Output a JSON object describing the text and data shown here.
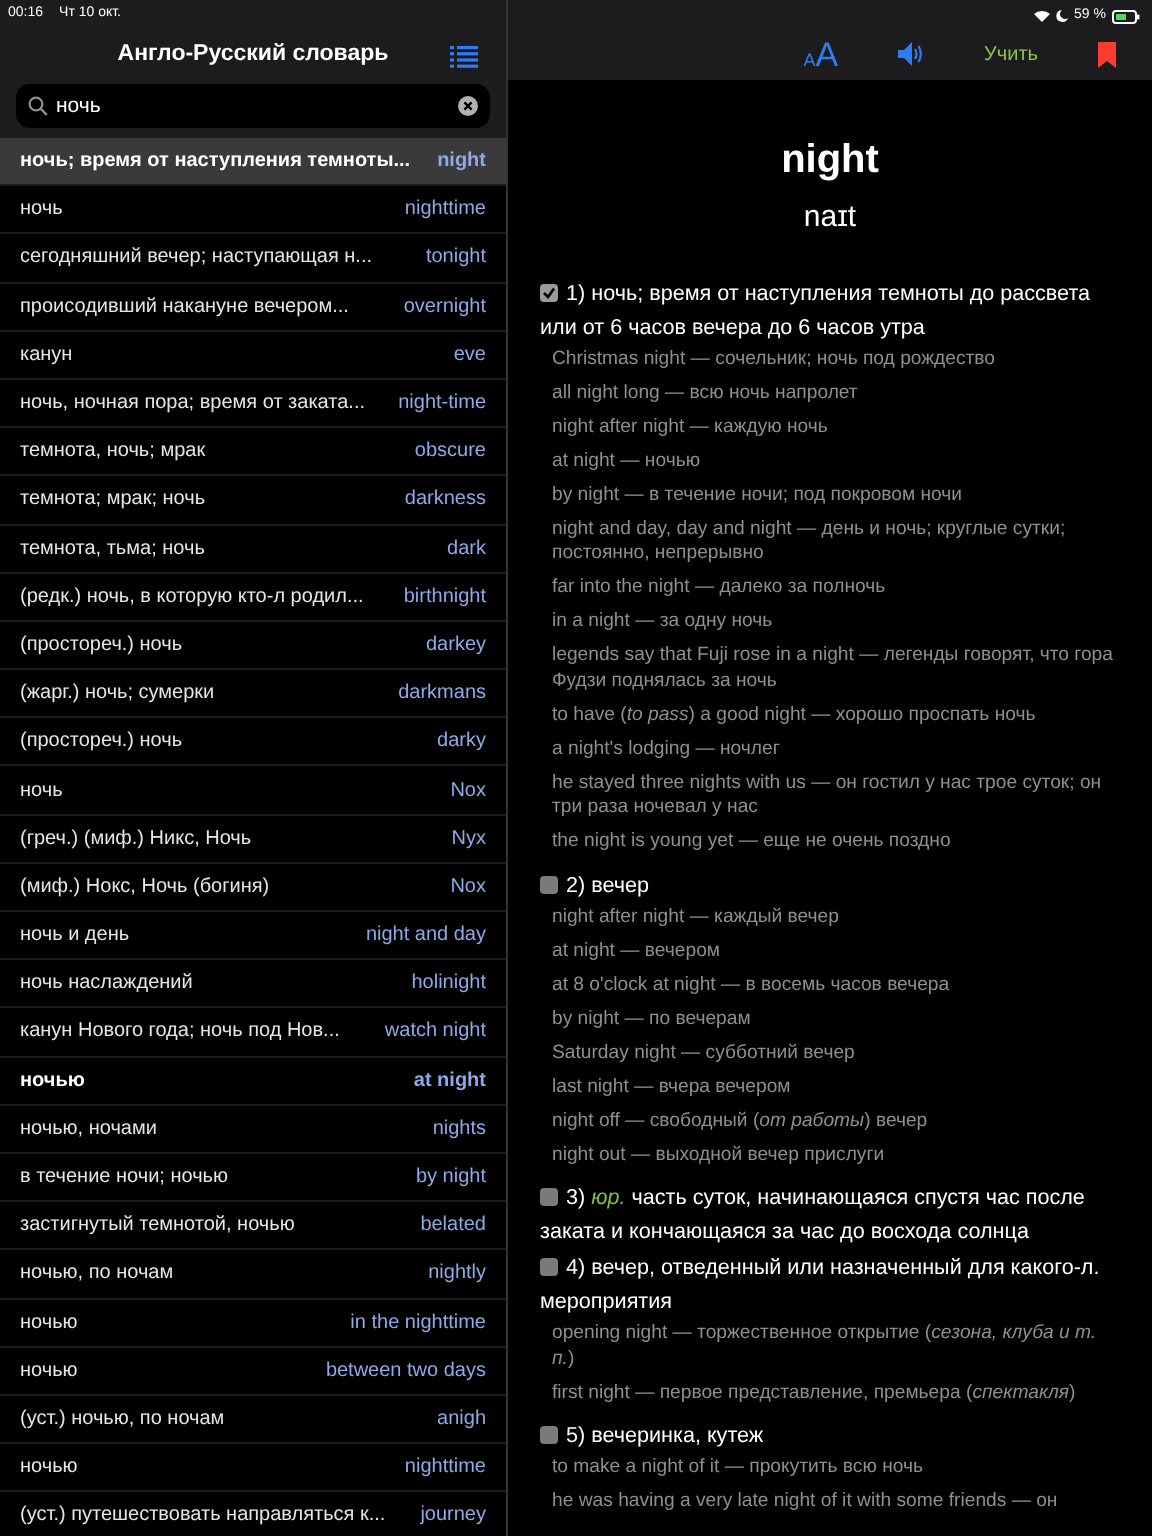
{
  "status_bar": {
    "time": "00:16",
    "date": "Чт 10 окт.",
    "battery": "59 %"
  },
  "sidebar": {
    "title": "Англо-Русский словарь",
    "search": {
      "value": "ночь"
    },
    "entries": [
      {
        "translation": "ночь; время от наступления темноты...",
        "word": "night",
        "selected": true,
        "bold": true
      },
      {
        "translation": "ночь",
        "word": "nighttime",
        "selected": false,
        "bold": false
      },
      {
        "translation": "сегодняшний вечер; наступающая н...",
        "word": "tonight",
        "selected": false,
        "bold": false
      },
      {
        "translation": "происодивший накануне вечером...",
        "word": "overnight",
        "selected": false,
        "bold": false
      },
      {
        "translation": "канун",
        "word": "eve",
        "selected": false,
        "bold": false
      },
      {
        "translation": "ночь, ночная пора; время от заката...",
        "word": "night-time",
        "selected": false,
        "bold": false
      },
      {
        "translation": "темнота, ночь; мрак",
        "word": "obscure",
        "selected": false,
        "bold": false
      },
      {
        "translation": "темнота; мрак; ночь",
        "word": "darkness",
        "selected": false,
        "bold": false
      },
      {
        "translation": "темнота, тьма; ночь",
        "word": "dark",
        "selected": false,
        "bold": false
      },
      {
        "translation": "(редк.) ночь, в которую кто-л родил...",
        "word": "birthnight",
        "selected": false,
        "bold": false
      },
      {
        "translation": "(простореч.) ночь",
        "word": "darkey",
        "selected": false,
        "bold": false
      },
      {
        "translation": "(жарг.) ночь; сумерки",
        "word": "darkmans",
        "selected": false,
        "bold": false
      },
      {
        "translation": "(простореч.) ночь",
        "word": "darky",
        "selected": false,
        "bold": false
      },
      {
        "translation": "ночь",
        "word": "Nox",
        "selected": false,
        "bold": false
      },
      {
        "translation": "(греч.) (миф.) Никс, Ночь",
        "word": "Nyx",
        "selected": false,
        "bold": false
      },
      {
        "translation": "(миф.) Нокс, Ночь (богиня)",
        "word": "Nox",
        "selected": false,
        "bold": false
      },
      {
        "translation": "ночь и день",
        "word": "night and day",
        "selected": false,
        "bold": false
      },
      {
        "translation": "ночь наслаждений",
        "word": "holinight",
        "selected": false,
        "bold": false
      },
      {
        "translation": "канун Нового года; ночь под Нов...",
        "word": "watch night",
        "selected": false,
        "bold": false
      },
      {
        "translation": "ночью",
        "word": "at night",
        "selected": false,
        "bold": true
      },
      {
        "translation": "ночью, ночами",
        "word": "nights",
        "selected": false,
        "bold": false
      },
      {
        "translation": "в течение ночи; ночью",
        "word": "by night",
        "selected": false,
        "bold": false
      },
      {
        "translation": "застигнутый темнотой, ночью",
        "word": "belated",
        "selected": false,
        "bold": false
      },
      {
        "translation": "ночью, по ночам",
        "word": "nightly",
        "selected": false,
        "bold": false
      },
      {
        "translation": "ночью",
        "word": "in the nighttime",
        "selected": false,
        "bold": false
      },
      {
        "translation": "ночью",
        "word": "between two days",
        "selected": false,
        "bold": false
      },
      {
        "translation": "(уст.) ночью, по ночам",
        "word": "anigh",
        "selected": false,
        "bold": false
      },
      {
        "translation": "ночью",
        "word": "nighttime",
        "selected": false,
        "bold": false
      },
      {
        "translation": "(уст.) путешествовать направляться к...",
        "word": "journey",
        "selected": false,
        "bold": false
      }
    ]
  },
  "toolbar": {
    "text_size": [
      "A",
      "A"
    ],
    "learn_button": "Учить"
  },
  "article": {
    "headword": "night",
    "transcription": "naɪt",
    "senses": [
      {
        "number": "1)",
        "text": "ночь; время от наступления темноты до рассвета или от 6 часов вечера до 6 часов утра",
        "checked": true,
        "examples": [
          "Christmas night — сочельник; ночь под рождество",
          "all night long — всю ночь напролет",
          "night after night — каждую ночь",
          "at night — ночью",
          "by night — в течение ночи; под покровом ночи",
          "night and day, day and night — день и ночь; круглые сутки; постоянно, непрерывно",
          "far into the night — далеко за полночь",
          "in a night — за одну ночь",
          "legends say that Fuji rose in a night — легенды говорят, что гора Фудзи поднялась за ночь",
          "to have (*to pass*) a good night — хорошо проспать ночь",
          "a night's lodging — ночлег",
          "he stayed three nights with us — он гостил у нас трое суток; он три раза ночевал у нас",
          "the night is young yet — еще не очень поздно"
        ]
      },
      {
        "number": "2)",
        "text": "вечер",
        "checked": false,
        "examples": [
          "night after night — каждый вечер",
          "at night — вечером",
          "at 8 o'clock at night — в восемь часов вечера",
          "by night — по вечерам",
          "Saturday night — субботний вечер",
          "last night — вчера вечером",
          "night off — свободный (*от работы*) вечер",
          "night out — выходной вечер прислуги"
        ]
      },
      {
        "number": "3)",
        "label": "юр.",
        "text": "часть суток, начинающаяся спустя час после заката и кончающаяся за час до восхода солнца",
        "checked": false
      },
      {
        "number": "4)",
        "text": "вечер, отведенный или назначенный для какого-л. мероприятия",
        "checked": false,
        "examples": [
          "opening night — торжественное открытие (*сезона, клуба и т. п.*)",
          "first night — первое представление, премьера (*спектакля*)"
        ]
      },
      {
        "number": "5)",
        "text": "вечеринка, кутеж",
        "checked": false,
        "examples": [
          "to make a night of it — прокутить всю ночь",
          "he was having a very late night of it with some friends — он"
        ]
      }
    ]
  }
}
